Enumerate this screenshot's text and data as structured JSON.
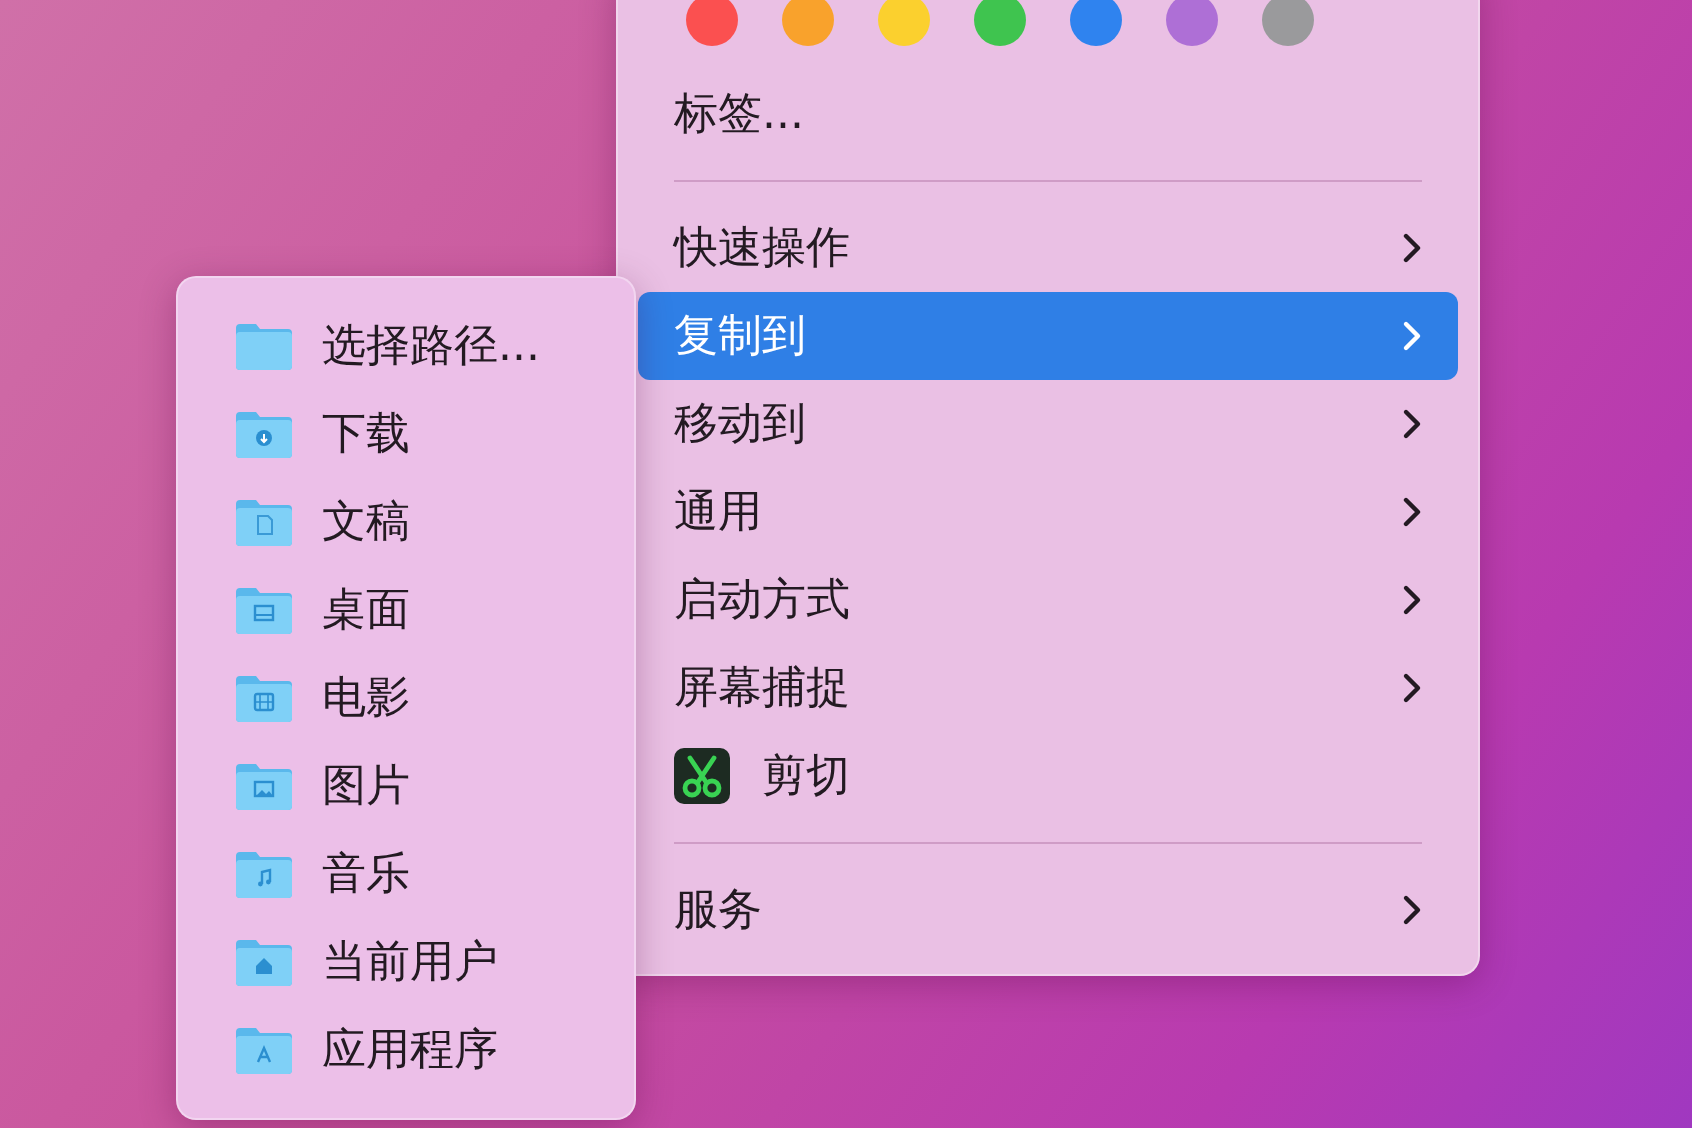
{
  "tag_colors": [
    {
      "color": "#fb5050"
    },
    {
      "color": "#f9a22c"
    },
    {
      "color": "#fbd02e"
    },
    {
      "color": "#3fc44f"
    },
    {
      "color": "#2f83ef"
    },
    {
      "color": "#ae6fd6"
    },
    {
      "color": "#9a9a9c"
    }
  ],
  "context_menu": [
    {
      "kind": "item",
      "label": "标签...",
      "submenu": false,
      "selected": false
    },
    {
      "kind": "separator"
    },
    {
      "kind": "item",
      "label": "快速操作",
      "submenu": true,
      "selected": false
    },
    {
      "kind": "item",
      "label": "复制到",
      "submenu": true,
      "selected": true
    },
    {
      "kind": "item",
      "label": "移动到",
      "submenu": true,
      "selected": false
    },
    {
      "kind": "item",
      "label": "通用",
      "submenu": true,
      "selected": false
    },
    {
      "kind": "item",
      "label": "启动方式",
      "submenu": true,
      "selected": false
    },
    {
      "kind": "item",
      "label": "屏幕捕捉",
      "submenu": true,
      "selected": false
    },
    {
      "kind": "app",
      "label": "剪切",
      "submenu": false,
      "selected": false
    },
    {
      "kind": "separator"
    },
    {
      "kind": "item",
      "label": "服务",
      "submenu": true,
      "selected": false
    }
  ],
  "submenu": [
    {
      "kind": "plain",
      "label": "选择路径..."
    },
    {
      "kind": "download",
      "label": "下载"
    },
    {
      "kind": "document",
      "label": "文稿"
    },
    {
      "kind": "desktop",
      "label": "桌面"
    },
    {
      "kind": "movies",
      "label": "电影"
    },
    {
      "kind": "pictures",
      "label": "图片"
    },
    {
      "kind": "music",
      "label": "音乐"
    },
    {
      "kind": "home",
      "label": "当前用户"
    },
    {
      "kind": "applications",
      "label": "应用程序"
    }
  ]
}
